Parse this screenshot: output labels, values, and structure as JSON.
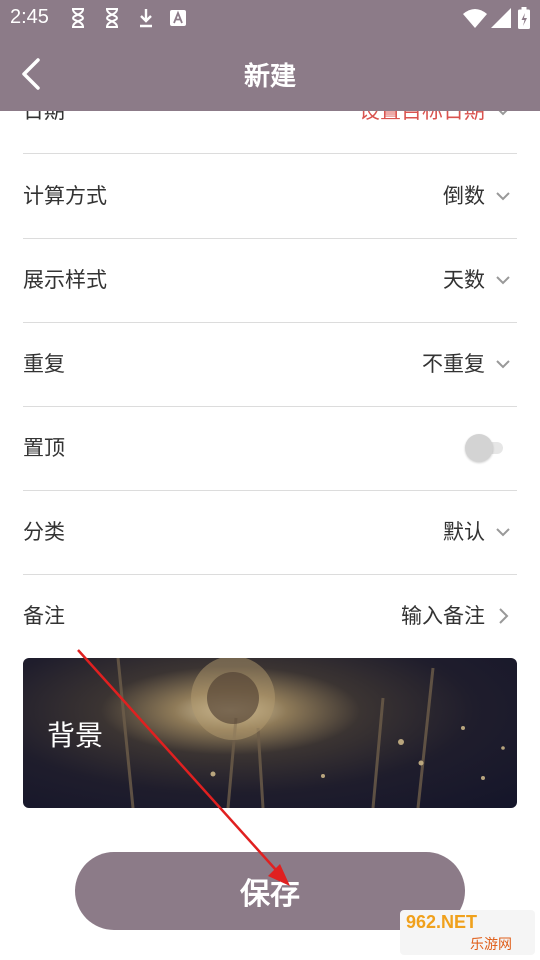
{
  "status_bar": {
    "time": "2:45",
    "icons": [
      "hourglass-icon",
      "hourglass-icon",
      "download-icon",
      "text-a-icon",
      "wifi-icon",
      "signal-icon",
      "battery-icon"
    ]
  },
  "app_bar": {
    "title": "新建",
    "back_icon": "chevron-left-icon"
  },
  "form": {
    "rows": [
      {
        "label": "日期",
        "value": "设置目标日期",
        "control": "dropdown"
      },
      {
        "label": "计算方式",
        "value": "倒数",
        "control": "dropdown"
      },
      {
        "label": "展示样式",
        "value": "天数",
        "control": "dropdown"
      },
      {
        "label": "重复",
        "value": "不重复",
        "control": "dropdown"
      },
      {
        "label": "置顶",
        "value": "",
        "control": "toggle",
        "toggle_on": false
      },
      {
        "label": "分类",
        "value": "默认",
        "control": "dropdown"
      },
      {
        "label": "备注",
        "value": "输入备注",
        "control": "chevron-right"
      }
    ]
  },
  "background_card": {
    "label": "背景"
  },
  "save_button": {
    "label": "保存"
  },
  "watermark": {
    "line1": "962.NET",
    "line2": "乐游网"
  },
  "colors": {
    "primary": "#8c7b88",
    "accent_red": "#d9534f",
    "divider": "#dcdcdc",
    "annotation_arrow": "#e02020"
  }
}
